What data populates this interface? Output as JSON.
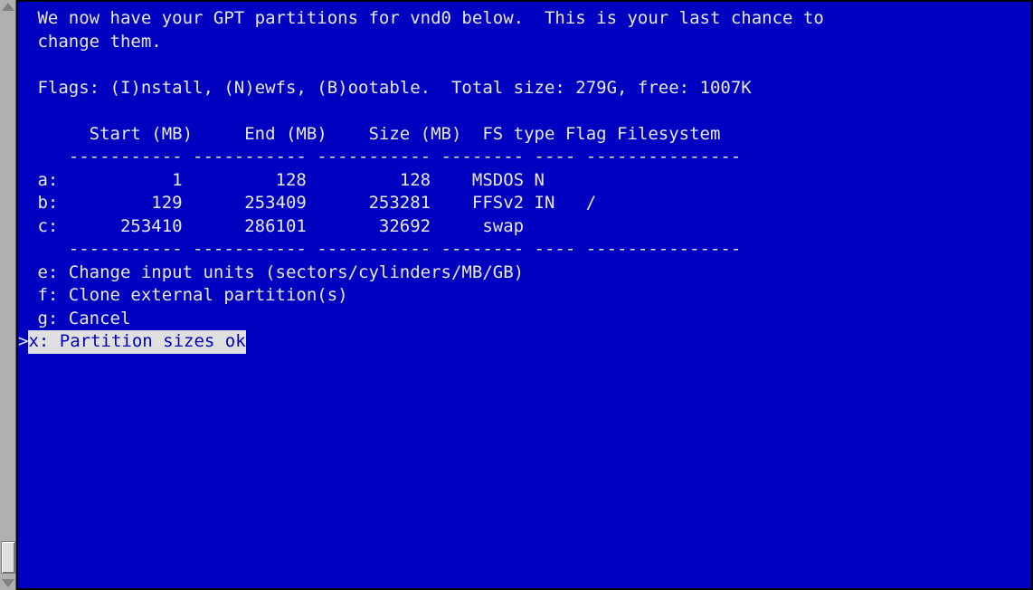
{
  "intro": {
    "line1": " We now have your GPT partitions for vnd0 below.  This is your last chance to",
    "line2": " change them."
  },
  "flagsline": " Flags: (I)nstall, (N)ewfs, (B)ootable.  Total size: 279G, free: 1007K",
  "headers": {
    "cols": "      Start (MB)     End (MB)    Size (MB)  FS type Flag Filesystem",
    "rule": "    ----------- ----------- ----------- -------- ---- ---------------"
  },
  "rows": {
    "a": " a:           1         128         128    MSDOS N",
    "b": " b:         129      253409      253281    FFSv2 IN   /",
    "c": " c:      253410      286101       32692     swap"
  },
  "menu": {
    "e": " e: Change input units (sectors/cylinders/MB/GB)",
    "f": " f: Clone external partition(s)",
    "g": " g: Cancel",
    "x": "x: Partition sizes ok"
  },
  "cursor": ">"
}
